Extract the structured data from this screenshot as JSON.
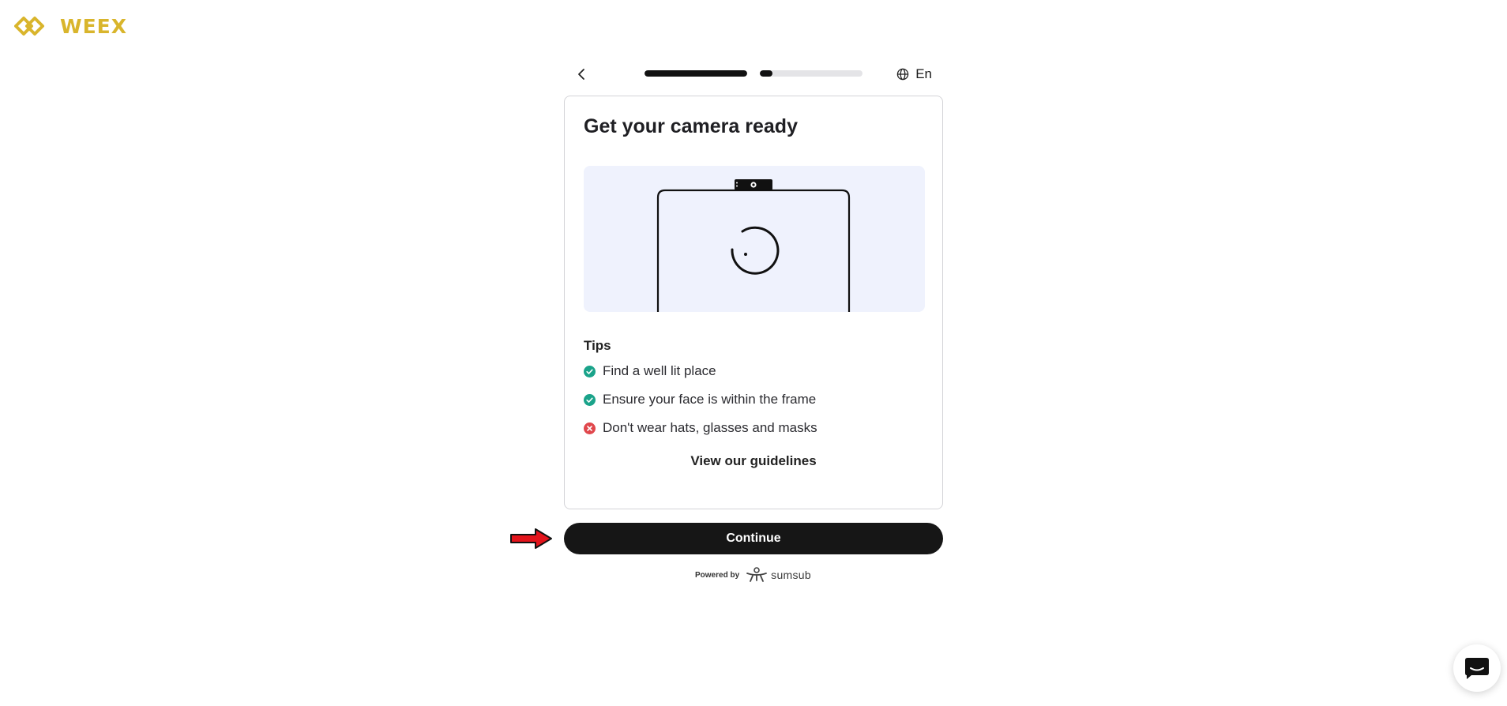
{
  "brand": {
    "logo_text": "WEEX",
    "color": "#d9b52c"
  },
  "header": {
    "language": "En",
    "progress": [
      {
        "filled_fraction": 1.0
      },
      {
        "filled_fraction": 0.12
      }
    ]
  },
  "card": {
    "title": "Get your camera ready",
    "tips_title": "Tips",
    "tips": [
      {
        "text": "Find a well lit place",
        "status": "ok",
        "color": "#1aa38a"
      },
      {
        "text": "Ensure your face is within the frame",
        "status": "ok",
        "color": "#1aa38a"
      },
      {
        "text": "Don't wear hats, glasses and masks",
        "status": "not-ok",
        "color": "#e0474c"
      }
    ],
    "guidelines_link": "View our guidelines"
  },
  "actions": {
    "continue_label": "Continue"
  },
  "footer": {
    "powered_by": "Powered by",
    "provider": "sumsub"
  },
  "icons": {
    "back": "chevron-left-icon",
    "language": "globe-icon",
    "chat": "chat-bubble-icon",
    "pointer": "red-arrow-icon"
  }
}
